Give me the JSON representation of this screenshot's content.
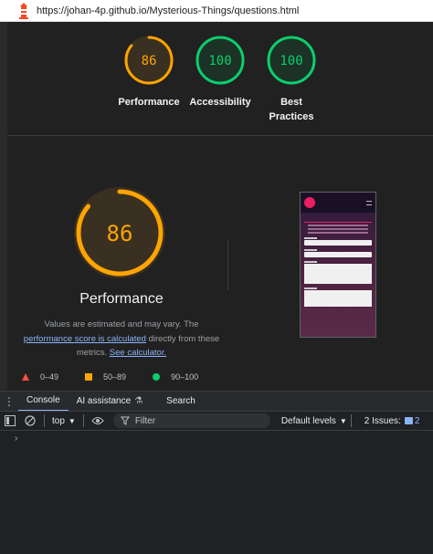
{
  "address_bar": {
    "url": "https://johan-4p.github.io/Mysterious-Things/questions.html"
  },
  "top_gauges": [
    {
      "score": "86",
      "label_line1": "Performance",
      "label_line2": "",
      "score_fraction": 0.86,
      "color": "#ffa400"
    },
    {
      "score": "100",
      "label_line1": "Accessibility",
      "label_line2": "",
      "score_fraction": 1.0,
      "color": "#0cce6b"
    },
    {
      "score": "100",
      "label_line1": "Best",
      "label_line2": "Practices",
      "score_fraction": 1.0,
      "color": "#0cce6b"
    }
  ],
  "performance": {
    "score": "86",
    "score_fraction": 0.86,
    "title": "Performance",
    "desc_1": "Values are estimated and may vary. The",
    "desc_link": "performance score is calculated",
    "desc_2": "directly from these metrics.",
    "calc_link": "See calculator."
  },
  "legend": [
    {
      "range": "0–49",
      "icon": "red-triangle-icon",
      "color": "#ff4e42"
    },
    {
      "range": "50–89",
      "icon": "orange-square-icon",
      "color": "#ffa400"
    },
    {
      "range": "90–100",
      "icon": "green-circle-icon",
      "color": "#0cce6b"
    }
  ],
  "drawer": {
    "tabs": [
      "Console",
      "AI assistance",
      "Search"
    ]
  },
  "console_toolbar": {
    "context": "top",
    "filter_placeholder": "Filter",
    "levels": "Default levels",
    "issues_label": "2 Issues:",
    "issues_count": "2"
  },
  "console": {
    "prompt": "›"
  }
}
